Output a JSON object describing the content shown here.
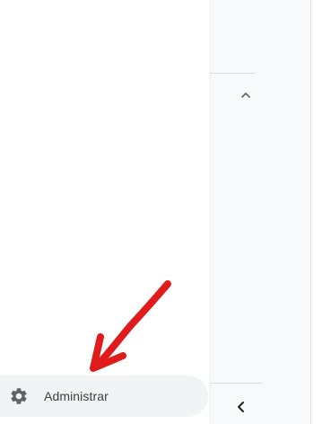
{
  "sidebar": {
    "manage_label": "Administrar",
    "manage_icon": "gear-icon"
  },
  "panel": {
    "collapse_icon": "chevron-up-icon",
    "back_icon": "chevron-left-icon"
  },
  "annotation": {
    "arrow_color": "#e01b1b"
  }
}
